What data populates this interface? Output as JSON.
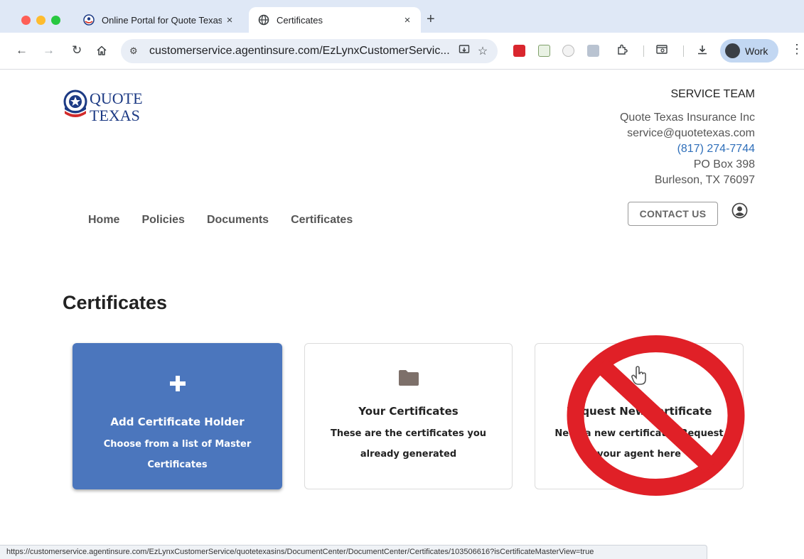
{
  "browser": {
    "tabs": [
      {
        "title": "Online Portal for Quote Texas",
        "close": "×",
        "active": false
      },
      {
        "title": "Certificates",
        "close": "×",
        "active": true
      }
    ],
    "new_tab": "+",
    "url": "customerservice.agentinsure.com/EzLynxCustomerServic...",
    "profile_label": "Work",
    "status_url": "https://customerservice.agentinsure.com/EzLynxCustomerService/quotetexasins/DocumentCenter/DocumentCenter/Certificates/103506616?isCertificateMasterView=true"
  },
  "header": {
    "logo_line1": "QUOTE",
    "logo_line2": "TEXAS",
    "service": {
      "heading": "SERVICE TEAM",
      "company": "Quote Texas Insurance Inc",
      "email": "service@quotetexas.com",
      "phone": "(817) 274-7744",
      "address1": "PO Box 398",
      "address2": "Burleson, TX 76097"
    },
    "contact_label": "CONTACT US"
  },
  "nav": {
    "items": [
      "Home",
      "Policies",
      "Documents",
      "Certificates"
    ]
  },
  "page_title": "Certificates",
  "cards": [
    {
      "icon": "plus-icon",
      "title": "Add Certificate Holder",
      "description": "Choose from a list of Master Certificates"
    },
    {
      "icon": "folder-icon",
      "title": "Your Certificates",
      "description": "These are the certificates you already generated"
    },
    {
      "icon": "pointing-hand-icon",
      "title": "Request New Certificate",
      "description": "Need a new certificate? Request your agent here"
    }
  ],
  "colors": {
    "accent_blue": "#4b76bd",
    "prohibited_red": "#e02027",
    "phone_link": "#2f6fba"
  }
}
